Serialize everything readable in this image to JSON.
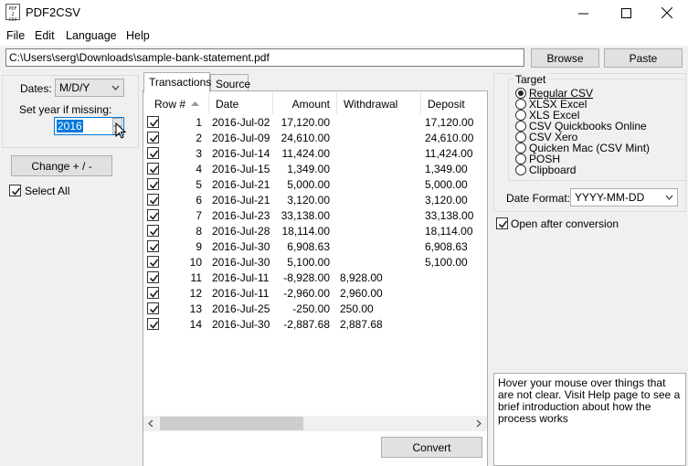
{
  "window": {
    "title": "PDF2CSV",
    "icon_text": [
      "PDF",
      "2",
      "CSV"
    ]
  },
  "menu": [
    "File",
    "Edit",
    "Language",
    "Help"
  ],
  "toolbar": {
    "path_value": "C:\\Users\\serg\\Downloads\\sample-bank-statement.pdf",
    "browse_label": "Browse",
    "paste_label": "Paste"
  },
  "left_panel": {
    "dates_label": "Dates:",
    "dates_value": "M/D/Y",
    "year_label": "Set year if missing:",
    "year_value": "2016",
    "change_button": "Change + / -",
    "select_all_label": "Select All",
    "select_all_checked": true
  },
  "tabs": [
    {
      "label": "Transactions",
      "active": true
    },
    {
      "label": "Source",
      "active": false
    }
  ],
  "grid": {
    "columns": [
      "Row #",
      "Date",
      "Amount",
      "Withdrawal",
      "Deposit"
    ],
    "rows": [
      {
        "checked": true,
        "row": "1",
        "date": "2016-Jul-02",
        "amount": "17,120.00",
        "withdrawal": "",
        "deposit": "17,120.00"
      },
      {
        "checked": true,
        "row": "2",
        "date": "2016-Jul-09",
        "amount": "24,610.00",
        "withdrawal": "",
        "deposit": "24,610.00"
      },
      {
        "checked": true,
        "row": "3",
        "date": "2016-Jul-14",
        "amount": "11,424.00",
        "withdrawal": "",
        "deposit": "11,424.00"
      },
      {
        "checked": true,
        "row": "4",
        "date": "2016-Jul-15",
        "amount": "1,349.00",
        "withdrawal": "",
        "deposit": "1,349.00"
      },
      {
        "checked": true,
        "row": "5",
        "date": "2016-Jul-21",
        "amount": "5,000.00",
        "withdrawal": "",
        "deposit": "5,000.00"
      },
      {
        "checked": true,
        "row": "6",
        "date": "2016-Jul-21",
        "amount": "3,120.00",
        "withdrawal": "",
        "deposit": "3,120.00"
      },
      {
        "checked": true,
        "row": "7",
        "date": "2016-Jul-23",
        "amount": "33,138.00",
        "withdrawal": "",
        "deposit": "33,138.00"
      },
      {
        "checked": true,
        "row": "8",
        "date": "2016-Jul-28",
        "amount": "18,114.00",
        "withdrawal": "",
        "deposit": "18,114.00"
      },
      {
        "checked": true,
        "row": "9",
        "date": "2016-Jul-30",
        "amount": "6,908.63",
        "withdrawal": "",
        "deposit": "6,908.63"
      },
      {
        "checked": true,
        "row": "10",
        "date": "2016-Jul-30",
        "amount": "5,100.00",
        "withdrawal": "",
        "deposit": "5,100.00"
      },
      {
        "checked": true,
        "row": "11",
        "date": "2016-Jul-11",
        "amount": "-8,928.00",
        "withdrawal": "8,928.00",
        "deposit": ""
      },
      {
        "checked": true,
        "row": "12",
        "date": "2016-Jul-11",
        "amount": "-2,960.00",
        "withdrawal": "2,960.00",
        "deposit": ""
      },
      {
        "checked": true,
        "row": "13",
        "date": "2016-Jul-25",
        "amount": "-250.00",
        "withdrawal": "250.00",
        "deposit": ""
      },
      {
        "checked": true,
        "row": "14",
        "date": "2016-Jul-30",
        "amount": "-2,887.68",
        "withdrawal": "2,887.68",
        "deposit": ""
      }
    ]
  },
  "convert_label": "Convert",
  "target": {
    "title": "Target",
    "options": [
      "Regular CSV",
      "XLSX Excel",
      "XLS Excel",
      "CSV Quickbooks Online",
      "CSV Xero",
      "Quicken Mac (CSV Mint)",
      "POSH",
      "Clipboard"
    ],
    "selected": "Regular CSV"
  },
  "date_format": {
    "label": "Date Format:",
    "value": "YYYY-MM-DD"
  },
  "open_after": {
    "label": "Open after conversion",
    "checked": true
  },
  "help_text": "Hover your mouse over things that are not clear. Visit Help page to see a brief introduction about how the process works"
}
